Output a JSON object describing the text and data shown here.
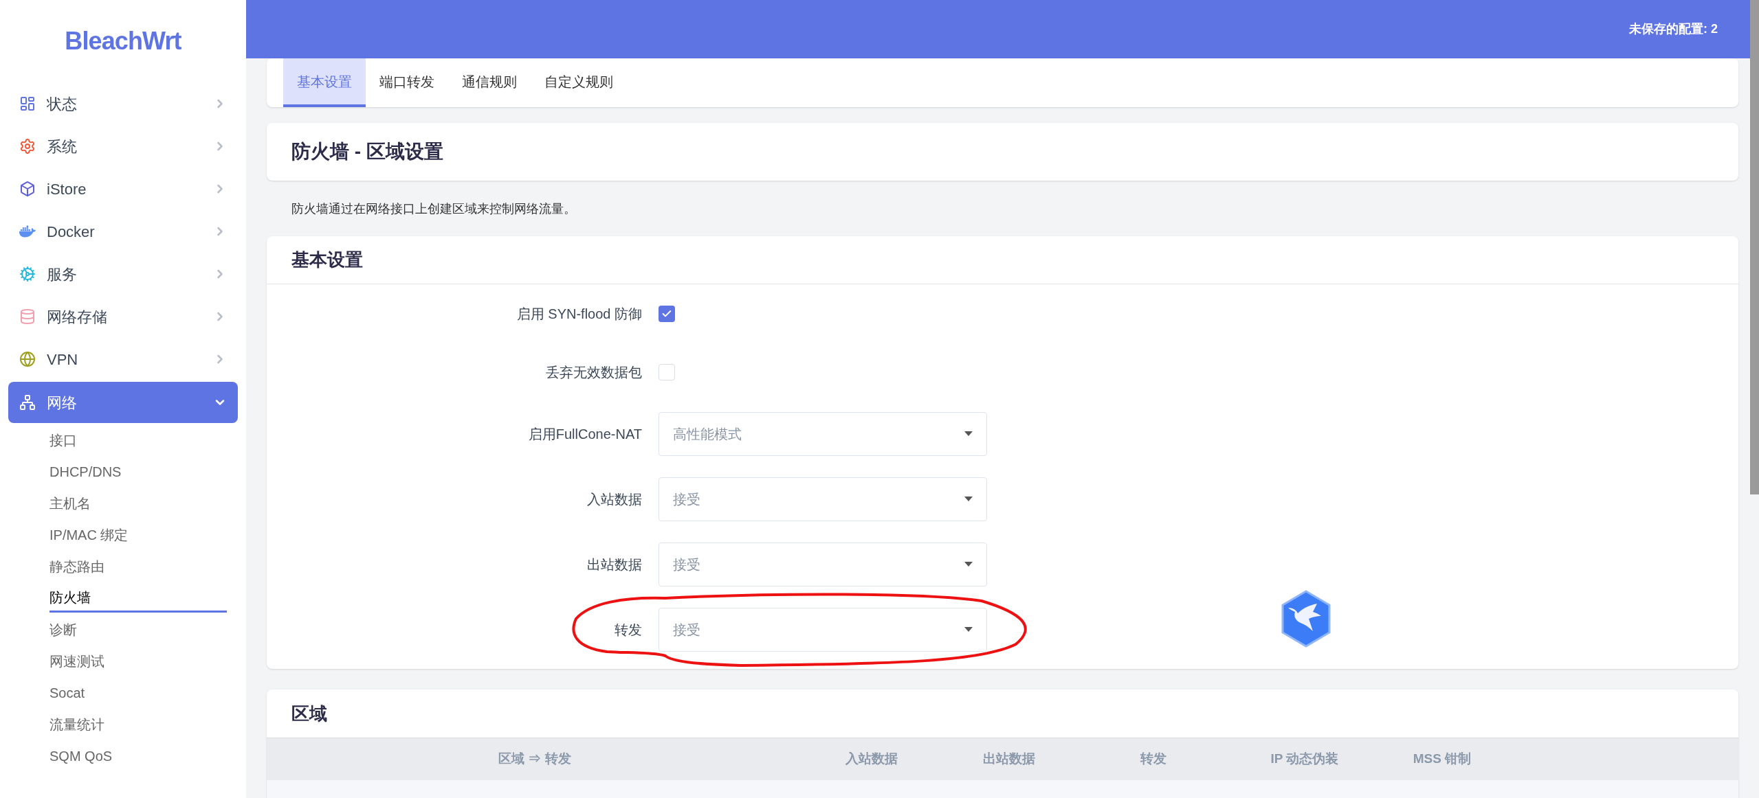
{
  "brand": "BleachWrt",
  "sidebar": {
    "items": [
      {
        "label": "状态",
        "selected": false,
        "expanded": false
      },
      {
        "label": "系统",
        "selected": false,
        "expanded": false
      },
      {
        "label": "iStore",
        "selected": false,
        "expanded": false
      },
      {
        "label": "Docker",
        "selected": false,
        "expanded": false
      },
      {
        "label": "服务",
        "selected": false,
        "expanded": false
      },
      {
        "label": "网络存储",
        "selected": false,
        "expanded": false
      },
      {
        "label": "VPN",
        "selected": false,
        "expanded": false
      },
      {
        "label": "网络",
        "selected": true,
        "expanded": true,
        "children": [
          {
            "label": "接口",
            "selected": false
          },
          {
            "label": "DHCP/DNS",
            "selected": false
          },
          {
            "label": "主机名",
            "selected": false
          },
          {
            "label": "IP/MAC 绑定",
            "selected": false
          },
          {
            "label": "静态路由",
            "selected": false
          },
          {
            "label": "防火墙",
            "selected": true
          },
          {
            "label": "诊断",
            "selected": false
          },
          {
            "label": "网速测试",
            "selected": false
          },
          {
            "label": "Socat",
            "selected": false
          },
          {
            "label": "流量统计",
            "selected": false
          },
          {
            "label": "SQM QoS",
            "selected": false
          }
        ]
      }
    ]
  },
  "header": {
    "unsaved": "未保存的配置: 2"
  },
  "tabs": [
    {
      "label": "基本设置",
      "selected": true
    },
    {
      "label": "端口转发",
      "selected": false
    },
    {
      "label": "通信规则",
      "selected": false
    },
    {
      "label": "自定义规则",
      "selected": false
    }
  ],
  "page": {
    "title": "防火墙 - 区域设置",
    "description": "防火墙通过在网络接口上创建区域来控制网络流量。"
  },
  "basic_settings": {
    "title": "基本设置",
    "rows": [
      {
        "kind": "checkbox",
        "label": "启用 SYN-flood 防御",
        "checked": true
      },
      {
        "kind": "checkbox",
        "label": "丢弃无效数据包",
        "checked": false
      },
      {
        "kind": "select",
        "label": "启用FullCone-NAT",
        "value": "高性能模式",
        "annotated": false
      },
      {
        "kind": "select",
        "label": "入站数据",
        "value": "接受",
        "annotated": false
      },
      {
        "kind": "select",
        "label": "出站数据",
        "value": "接受",
        "annotated": false
      },
      {
        "kind": "select",
        "label": "转发",
        "value": "接受",
        "annotated": true
      }
    ]
  },
  "zones": {
    "title": "区域",
    "columns": [
      "区域 ⇒ 转发",
      "入站数据",
      "出站数据",
      "转发",
      "IP 动态伪装",
      "MSS 钳制"
    ]
  }
}
